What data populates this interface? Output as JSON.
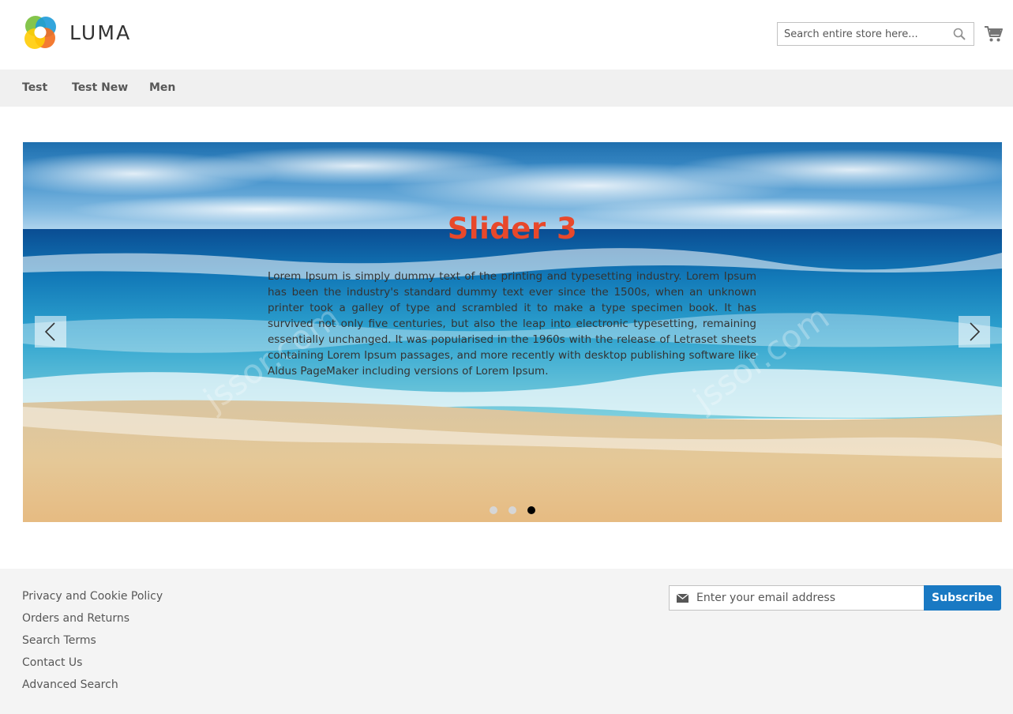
{
  "header": {
    "logo_text": "LUMA",
    "search": {
      "placeholder": "Search entire store here...",
      "value": ""
    },
    "icons": {
      "search": "search-icon",
      "cart": "cart-icon",
      "logo": "luma-logo-icon"
    }
  },
  "nav": {
    "items": [
      {
        "label": "Test"
      },
      {
        "label": "Test New"
      },
      {
        "label": "Men"
      }
    ]
  },
  "slider": {
    "title": "Slider 3",
    "body": "Lorem Ipsum is simply dummy text of the printing and typesetting industry. Lorem Ipsum has been the industry's standard dummy text ever since the 1500s, when an unknown printer took a galley of type and scrambled it to make a type specimen book. It has survived not only five centuries, but also the leap into electronic typesetting, remaining essentially unchanged. It was popularised in the 1960s with the release of Letraset sheets containing Lorem Ipsum passages, and more recently with desktop publishing software like Aldus PageMaker including versions of Lorem Ipsum.",
    "watermark": "jssor.com",
    "slide_count": 3,
    "active_slide": 3,
    "icons": {
      "prev": "chevron-left-icon",
      "next": "chevron-right-icon"
    }
  },
  "footer": {
    "links": [
      {
        "label": "Privacy and Cookie Policy"
      },
      {
        "label": "Orders and Returns"
      },
      {
        "label": "Search Terms"
      },
      {
        "label": "Contact Us"
      },
      {
        "label": "Advanced Search"
      }
    ],
    "newsletter": {
      "placeholder": "Enter your email address",
      "button_label": "Subscribe",
      "icon": "envelope-icon"
    }
  },
  "colors": {
    "title": "#e8482b",
    "accent": "#1979c3",
    "nav_bg": "#f0f0f0",
    "footer_bg": "#f4f4f4"
  }
}
